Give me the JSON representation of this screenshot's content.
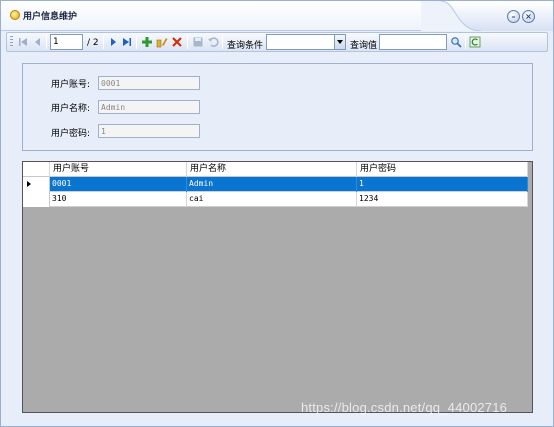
{
  "window": {
    "title": "用户信息维护",
    "icon": "gear-icon",
    "minimize_icon": "minimize-icon",
    "close_icon": "close-icon"
  },
  "toolbar": {
    "page_current": "1",
    "page_total": "/ 2",
    "query_condition_label": "查询条件",
    "query_condition_value": "",
    "query_value_label": "查询值",
    "query_value": "",
    "icons": [
      "first-icon",
      "prev-icon",
      "next-icon",
      "last-icon",
      "add-icon",
      "edit-icon",
      "delete-icon",
      "save-icon",
      "undo-icon",
      "search-icon",
      "refresh-icon"
    ]
  },
  "form": {
    "account_label": "用户账号:",
    "account_value": "0001",
    "name_label": "用户名称:",
    "name_value": "Admin",
    "password_label": "用户密码:",
    "password_value": "1"
  },
  "grid": {
    "columns": [
      "用户账号",
      "用户名称",
      "用户密码"
    ],
    "rows": [
      {
        "account": "0001",
        "name": "Admin",
        "password": "1",
        "selected": true
      },
      {
        "account": "310",
        "name": "cai",
        "password": "1234",
        "selected": false
      }
    ]
  },
  "watermark": "https://blog.csdn.net/qq_44002716",
  "colors": {
    "selection": "#0a74d1",
    "grid_background": "#ababab",
    "window_background": "#e8eef9"
  }
}
